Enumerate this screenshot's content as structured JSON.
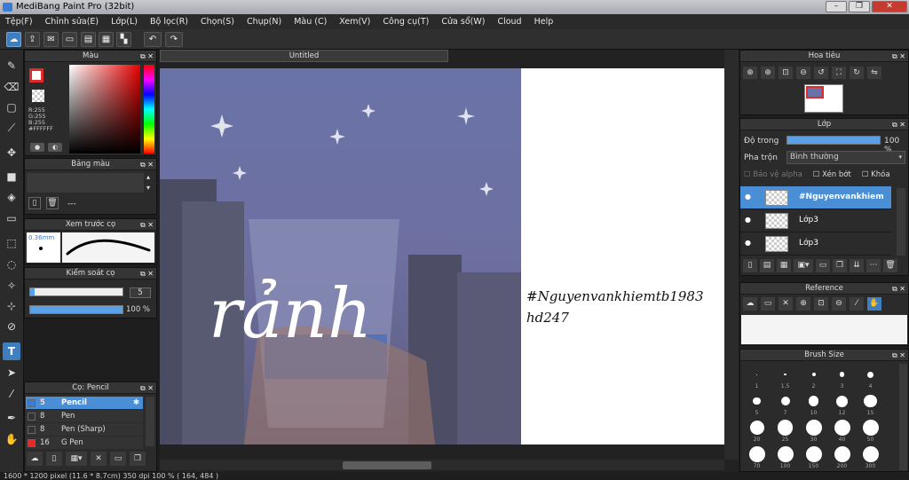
{
  "window": {
    "title": "MediBang Paint Pro (32bit)",
    "min": "–",
    "max": "❐",
    "close": "✕"
  },
  "menu": [
    "Tệp(F)",
    "Chỉnh sửa(E)",
    "Lớp(L)",
    "Bộ lọc(R)",
    "Chọn(S)",
    "Chụp(N)",
    "Màu (C)",
    "Xem(V)",
    "Công cụ(T)",
    "Cửa sổ(W)",
    "Cloud",
    "Help"
  ],
  "toolbar": {
    "icons": [
      "cloud-icon",
      "upload-icon",
      "chat-icon",
      "document-icon",
      "page-icon",
      "grid-icon",
      "panels-icon",
      "undo-icon",
      "redo-icon"
    ]
  },
  "left_tools": {
    "active": "text-tool",
    "text_glyph": "T"
  },
  "color_panel": {
    "title": "Màu",
    "r": "R:255",
    "g": "G:255",
    "b": "B:255",
    "hex": "#FFFFFF"
  },
  "palette_panel": {
    "title": "Bảng màu",
    "value": "---"
  },
  "brush_preview": {
    "title": "Xem trước cọ",
    "size": "0.36mm"
  },
  "brush_control": {
    "title": "Kiểm soát cọ",
    "size_value": "5",
    "opacity_value": "100 %",
    "size_fill": 0.05,
    "opacity_fill": 1.0
  },
  "brush_list": {
    "title": "Cọ: Pencil",
    "items": [
      {
        "size": "5",
        "name": "Pencil",
        "color": "#3a7bd5",
        "selected": true
      },
      {
        "size": "8",
        "name": "Pen",
        "color": "#333333",
        "selected": false
      },
      {
        "size": "8",
        "name": "Pen (Sharp)",
        "color": "#333333",
        "selected": false
      },
      {
        "size": "16",
        "name": "G Pen",
        "color": "#e02b2b",
        "selected": false
      }
    ]
  },
  "document": {
    "tab_title": "Untitled"
  },
  "canvas": {
    "caption_word": "rảnh",
    "hashtag_line1": "#Nguyenvankhiemtb1983",
    "hashtag_line2": "hd247"
  },
  "navigator": {
    "title": "Hoa tiêu"
  },
  "layer_panel": {
    "title": "Lớp",
    "opacity_label": "Độ trong",
    "opacity_value": "100 %",
    "opacity_fill": 1.0,
    "blend_label": "Pha trộn",
    "blend_value": "Bình thường",
    "protect_alpha": "Bảo vệ alpha",
    "clipping": "Xén bớt",
    "lock": "Khóa",
    "layers": [
      {
        "name": "#Nguyenvankhiem",
        "selected": true
      },
      {
        "name": "Lớp3",
        "selected": false
      },
      {
        "name": "Lớp3",
        "selected": false
      }
    ]
  },
  "reference_panel": {
    "title": "Reference"
  },
  "brush_size_panel": {
    "title": "Brush Size",
    "sizes": [
      "1",
      "1.5",
      "2",
      "3",
      "4",
      "5",
      "7",
      "10",
      "12",
      "15",
      "20",
      "25",
      "30",
      "40",
      "50",
      "70",
      "100",
      "150",
      "200",
      "300"
    ]
  },
  "status": {
    "text": "1600 * 1200 pixel   (11.6 * 8.7cm)   350 dpi   100 %   ( 164, 484 )"
  }
}
